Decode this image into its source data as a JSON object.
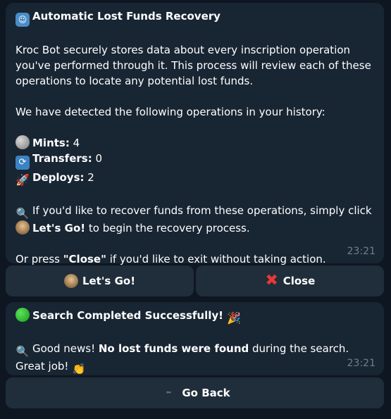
{
  "message1": {
    "title": "Automatic Lost Funds Recovery",
    "intro": "Kroc Bot securely stores data about every inscription operation you've performed through it. This process will review each of these operations to locate any potential lost funds.",
    "detected": "We have detected the following operations in your history:",
    "stats": [
      {
        "label": "Mints:",
        "value": "4",
        "icon": "coin-icon"
      },
      {
        "label": "Transfers:",
        "value": "0",
        "icon": "cycle-arrows-icon"
      },
      {
        "label": "Deploys:",
        "value": "2",
        "icon": "rocket-icon"
      }
    ],
    "recover_text_a": "If you'd like to recover funds from these operations, simply click",
    "recover_bold": "Let's Go!",
    "recover_text_b": "to begin the recovery process.",
    "close_text_a": "Or press ",
    "close_bold": "\"Close\"",
    "close_text_b": " if you'd like to exit without taking action.",
    "time": "23:21"
  },
  "buttons1": {
    "lets_go": "Let's Go!",
    "close": "Close"
  },
  "message2": {
    "title": "Search Completed Successfully!",
    "text_a": "Good news! ",
    "text_bold": "No lost funds were found",
    "text_b": " during the search. Great job!",
    "time": "23:21"
  },
  "buttons2": {
    "go_back": "Go Back"
  }
}
